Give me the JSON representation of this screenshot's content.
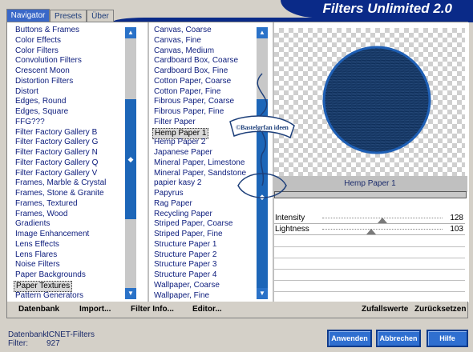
{
  "title": "Filters Unlimited 2.0",
  "tabs": [
    {
      "label": "Navigator",
      "active": true
    },
    {
      "label": "Presets",
      "active": false
    },
    {
      "label": "Über",
      "active": false
    }
  ],
  "categories": {
    "items": [
      "Buttons & Frames",
      "Color Effects",
      "Color Filters",
      "Convolution Filters",
      "Crescent Moon",
      "Distortion Filters",
      "Distort",
      "Edges, Round",
      "Edges, Square",
      "FFG???",
      "Filter Factory Gallery B",
      "Filter Factory Gallery G",
      "Filter Factory Gallery N",
      "Filter Factory Gallery Q",
      "Filter Factory Gallery V",
      "Frames, Marble & Crystal",
      "Frames, Stone & Granite",
      "Frames, Textured",
      "Frames, Wood",
      "Gradients",
      "Image Enhancement",
      "Lens Effects",
      "Lens Flares",
      "Noise Filters",
      "Paper Backgrounds",
      "Paper Textures",
      "Pattern Generators"
    ],
    "selected": "Paper Textures"
  },
  "filters": {
    "items": [
      "Canvas, Coarse",
      "Canvas, Fine",
      "Canvas, Medium",
      "Cardboard Box, Coarse",
      "Cardboard Box, Fine",
      "Cotton Paper, Coarse",
      "Cotton Paper, Fine",
      "Fibrous Paper, Coarse",
      "Fibrous Paper, Fine",
      "Filter Paper",
      "Hemp Paper 1",
      "Hemp Paper 2",
      "Japanese Paper",
      "Mineral Paper, Limestone",
      "Mineral Paper, Sandstone",
      "papier kasy 2",
      "Papyrus",
      "Rag Paper",
      "Recycling Paper",
      "Striped Paper, Coarse",
      "Striped Paper, Fine",
      "Structure Paper 1",
      "Structure Paper 2",
      "Structure Paper 3",
      "Structure Paper 4",
      "Wallpaper, Coarse",
      "Wallpaper, Fine"
    ],
    "selected": "Hemp Paper 1"
  },
  "watermark_text": "©Bastelgrfan ideen",
  "preview": {
    "filter_name": "Hemp Paper 1"
  },
  "parameters": [
    {
      "label": "Intensity",
      "value": "128",
      "level": 128,
      "max": 255
    },
    {
      "label": "Lightness",
      "value": "103",
      "level": 103,
      "max": 255
    }
  ],
  "toolbar": {
    "datenbank": "Datenbank",
    "import": "Import...",
    "filter_info": "Filter Info...",
    "editor": "Editor...",
    "zufallswerte": "Zufallswerte",
    "zuruecksetzen": "Zurücksetzen"
  },
  "footer": {
    "datenbank_label": "Datenbank:",
    "datenbank_value": "ICNET-Filters",
    "filter_label": "Filter:",
    "filter_value": "927"
  },
  "buttons": {
    "apply": "Anwenden",
    "cancel": "Abbrechen",
    "help": "Hilfe"
  },
  "colors": {
    "accent": "#0a2a88",
    "button": "#2f6fd0",
    "scroll": "#1d66b8"
  }
}
